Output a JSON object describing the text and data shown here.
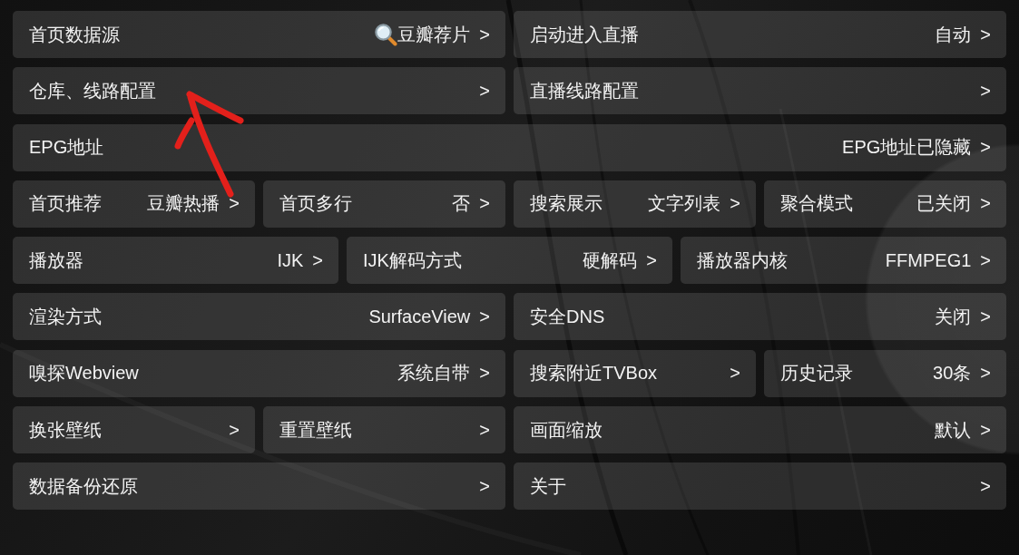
{
  "settings": {
    "rows": [
      {
        "items": [
          {
            "label": "首页数据源",
            "value": "豆瓣荐片",
            "icon": true,
            "chevron": ">"
          },
          {
            "label": "启动进入直播",
            "value": "自动",
            "chevron": ">"
          }
        ]
      },
      {
        "items": [
          {
            "label": "仓库、线路配置",
            "chevron": ">"
          },
          {
            "label": "直播线路配置",
            "chevron": ">"
          }
        ]
      },
      {
        "items": [
          {
            "label": "EPG地址",
            "value": "EPG地址已隐藏",
            "chevron": ">"
          }
        ]
      },
      {
        "items": [
          {
            "label": "首页推荐",
            "value": "豆瓣热播",
            "chevron": ">"
          },
          {
            "label": "首页多行",
            "value": "否",
            "chevron": ">"
          },
          {
            "label": "搜索展示",
            "value": "文字列表",
            "chevron": ">"
          },
          {
            "label": "聚合模式",
            "value": "已关闭",
            "chevron": ">"
          }
        ]
      },
      {
        "items": [
          {
            "label": "播放器",
            "value": "IJK",
            "chevron": ">"
          },
          {
            "label": "IJK解码方式",
            "value": "硬解码",
            "chevron": ">"
          },
          {
            "label": "播放器内核",
            "value": "FFMPEG1",
            "chevron": ">"
          }
        ]
      },
      {
        "items": [
          {
            "label": "渲染方式",
            "value": "SurfaceView",
            "chevron": ">"
          },
          {
            "label": "安全DNS",
            "value": "关闭",
            "chevron": ">"
          }
        ]
      },
      {
        "items": [
          {
            "label": "嗅探Webview",
            "value": "系统自带",
            "chevron": ">"
          },
          {
            "label": "搜索附近TVBox",
            "chevron": ">"
          },
          {
            "label": "历史记录",
            "value": "30条",
            "chevron": ">"
          }
        ]
      },
      {
        "items": [
          {
            "label": "换张壁纸",
            "chevron": ">"
          },
          {
            "label": "重置壁纸",
            "chevron": ">"
          },
          {
            "label": "画面缩放",
            "value": "默认",
            "chevron": ">"
          }
        ]
      },
      {
        "items": [
          {
            "label": "数据备份还原",
            "chevron": ">"
          },
          {
            "label": "关于",
            "chevron": ">"
          }
        ]
      }
    ]
  }
}
